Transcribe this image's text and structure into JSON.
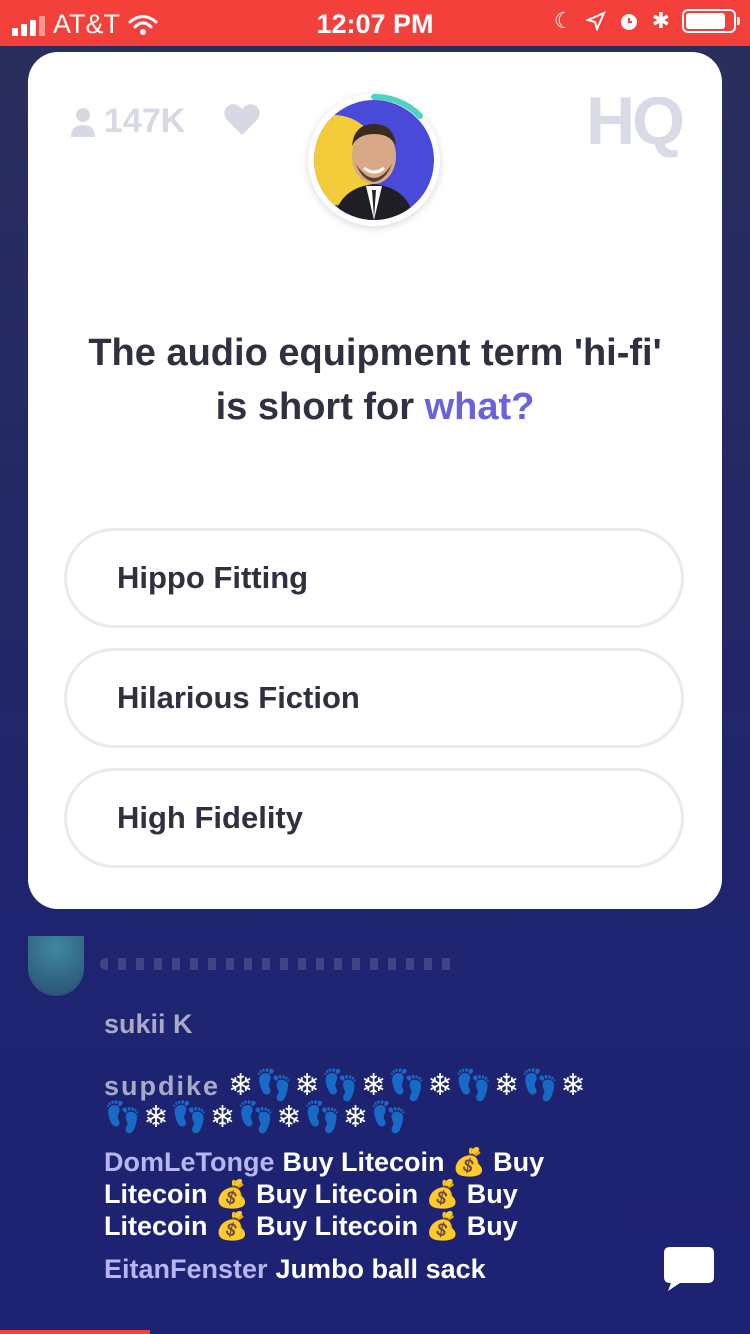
{
  "status_bar": {
    "carrier": "AT&T",
    "time": "12:07 PM"
  },
  "card": {
    "viewers": "147K",
    "logo": "HQ",
    "question_main": "The audio equipment term 'hi-fi' is short for ",
    "question_highlight": "what?",
    "answers": [
      "Hippo Fitting",
      "Hilarious Fiction",
      "High Fidelity"
    ]
  },
  "chat": [
    {
      "user": "sukii K",
      "message": ""
    },
    {
      "user": "supdike",
      "message": "❄👣❄👣❄👣❄👣❄👣❄👣❄👣❄👣❄👣❄👣"
    },
    {
      "user": "DomLeTonge",
      "message": "Buy Litecoin 💰 Buy Litecoin 💰 Buy Litecoin 💰 Buy Litecoin 💰 Buy Litecoin 💰 Buy"
    },
    {
      "user": "EitanFenster",
      "message": "Jumbo ball sack"
    }
  ],
  "colors": {
    "accent": "#f4403a",
    "highlight": "#6b63d9",
    "username": "#b7b6f3"
  }
}
